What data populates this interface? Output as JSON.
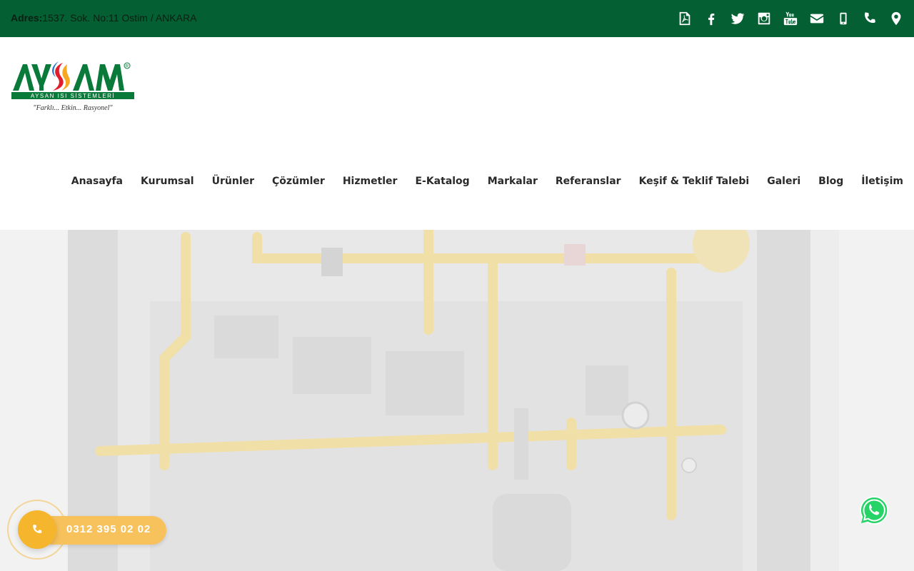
{
  "topbar": {
    "address_label": "Adres:",
    "address_value": "1537. Sok. No:11 Ostim / ANKARA",
    "icons": [
      "pdf-icon",
      "facebook-icon",
      "twitter-icon",
      "instagram-icon",
      "youtube-icon",
      "envelope-icon",
      "mobile-icon",
      "phone-icon",
      "map-marker-icon"
    ],
    "youtube_text": "You Tube"
  },
  "logo": {
    "brand": "AYSAN",
    "subtitle": "AYSAN ISI SİSTEMLERİ",
    "slogan": "\"Farklı... Etkin... Rasyonel\""
  },
  "nav": {
    "items": [
      "Anasayfa",
      "Kurumsal",
      "Ürünler",
      "Çözümler",
      "Hizmetler",
      "E-Katalog",
      "Markalar",
      "Referanslar",
      "Keşif & Teklif Talebi",
      "Galeri",
      "Blog",
      "İletişim"
    ]
  },
  "call": {
    "number": "0312 395 02 02"
  },
  "colors": {
    "topbar": "#045f33",
    "call_accent": "#f5b52c",
    "whatsapp": "#25d366"
  }
}
